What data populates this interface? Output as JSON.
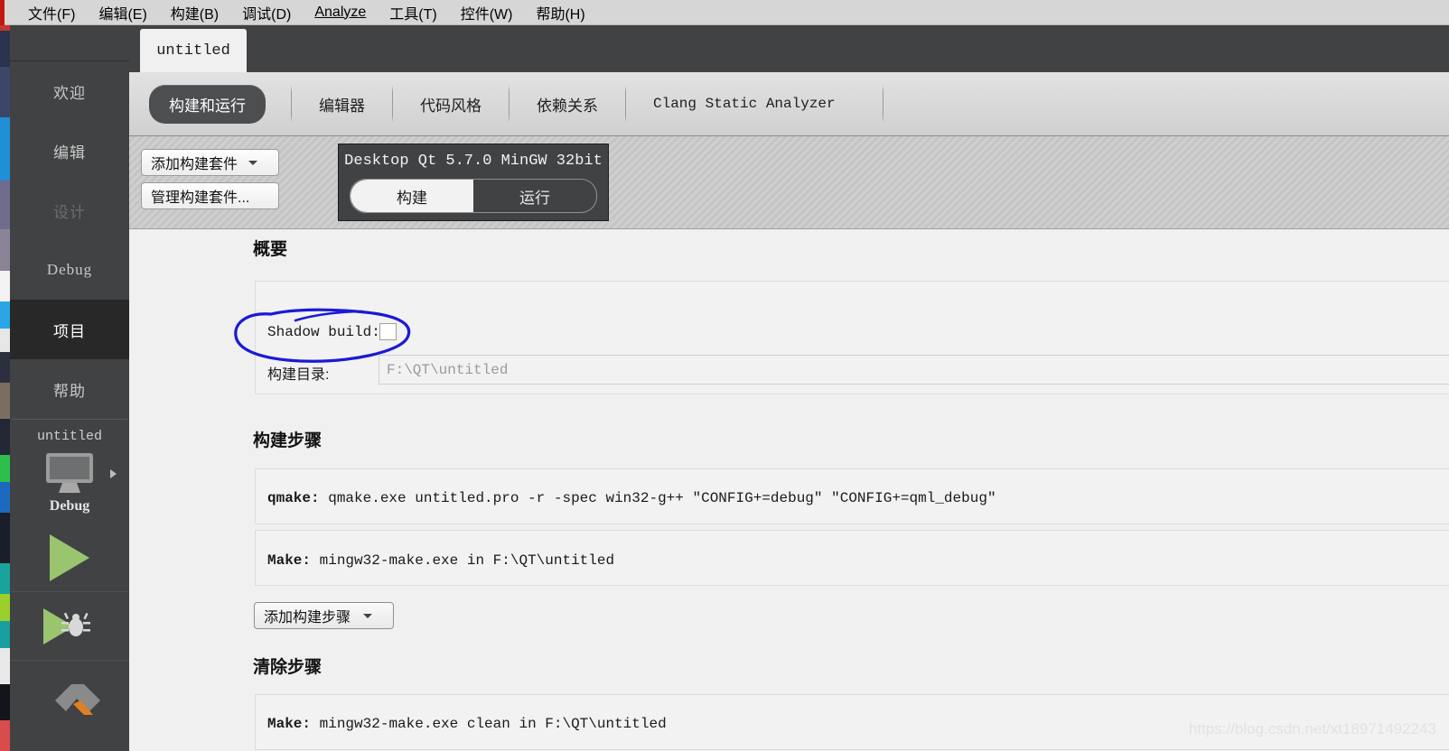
{
  "menubar": {
    "items": [
      {
        "text": "文件(F)",
        "mnemonic": "F"
      },
      {
        "text": "编辑(E)",
        "mnemonic": "E"
      },
      {
        "text": "构建(B)",
        "mnemonic": "B"
      },
      {
        "text": "调试(D)",
        "mnemonic": "D"
      },
      {
        "text": "Analyze",
        "mnemonic": "A"
      },
      {
        "text": "工具(T)",
        "mnemonic": "T"
      },
      {
        "text": "控件(W)",
        "mnemonic": "W"
      },
      {
        "text": "帮助(H)",
        "mnemonic": "H"
      }
    ]
  },
  "sidebar": {
    "modes": [
      {
        "label": "欢迎",
        "state": "normal"
      },
      {
        "label": "编辑",
        "state": "normal"
      },
      {
        "label": "设计",
        "state": "disabled"
      },
      {
        "label": "Debug",
        "state": "normal"
      },
      {
        "label": "项目",
        "state": "selected"
      },
      {
        "label": "帮助",
        "state": "normal"
      }
    ],
    "target": {
      "project": "untitled",
      "kit_icon": "desktop-monitor-icon",
      "build_config": "Debug",
      "expand_arrow": "chevron-right-icon"
    },
    "run_button": "run-icon",
    "debug_button": "debug-icon",
    "build_button": "hammer-icon"
  },
  "project_tab": {
    "label": "untitled"
  },
  "settings_tabs": [
    {
      "label": "构建和运行",
      "active": true,
      "mono": false
    },
    {
      "label": "编辑器",
      "active": false,
      "mono": false
    },
    {
      "label": "代码风格",
      "active": false,
      "mono": false
    },
    {
      "label": "依赖关系",
      "active": false,
      "mono": false
    },
    {
      "label": "Clang Static Analyzer",
      "active": false,
      "mono": true
    }
  ],
  "kitbar": {
    "add_kit_button": "添加构建套件",
    "manage_kits_button": "管理构建套件...",
    "selected_kit": "Desktop Qt 5.7.0 MinGW 32bit",
    "toggle": {
      "build": "构建",
      "run": "运行",
      "active": "构建"
    }
  },
  "summary": {
    "title": "概要",
    "shadow_build_label": "Shadow build:",
    "shadow_build_checked": false,
    "build_dir_label": "构建目录:",
    "build_dir_value": "F:\\QT\\untitled"
  },
  "build_steps": {
    "title": "构建步骤",
    "steps": [
      {
        "name": "qmake:",
        "command": "qmake.exe untitled.pro -r -spec win32-g++ \"CONFIG+=debug\" \"CONFIG+=qml_debug\""
      },
      {
        "name": "Make:",
        "command": "mingw32-make.exe in F:\\QT\\untitled"
      }
    ],
    "add_button": "添加构建步骤"
  },
  "clean_steps": {
    "title": "清除步骤",
    "steps": [
      {
        "name": "Make:",
        "command": "mingw32-make.exe clean in F:\\QT\\untitled"
      }
    ]
  },
  "annotation": {
    "shape": "hand-drawn-ellipse",
    "color": "#1a1ad6",
    "target": "shadow-build-checkbox"
  },
  "watermark": {
    "text": "https://blog.csdn.net/xt18971492243"
  },
  "colors": {
    "sidebar_bg": "#414244",
    "sidebar_selected": "#282829",
    "content_bg": "#f0f0f0",
    "panel_bg": "#f2f2f2",
    "accent_green": "#9ac46e",
    "annotation_blue": "#1a1ad6"
  }
}
